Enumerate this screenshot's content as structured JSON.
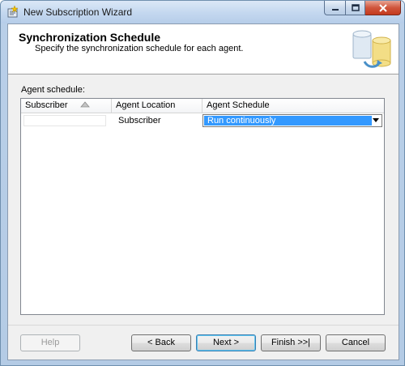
{
  "window": {
    "title": "New Subscription Wizard"
  },
  "header": {
    "title": "Synchronization Schedule",
    "subtitle": "Specify the synchronization schedule for each agent."
  },
  "grid": {
    "label": "Agent schedule:",
    "columns": [
      "Subscriber",
      "Agent Location",
      "Agent Schedule"
    ],
    "sort_column": "Subscriber",
    "sort_direction": "ascending",
    "rows": [
      {
        "subscriber": "",
        "agent_location": "Subscriber",
        "agent_schedule": "Run continuously"
      }
    ]
  },
  "buttons": {
    "help": "Help",
    "back": "< Back",
    "next": "Next >",
    "finish": "Finish >>|",
    "cancel": "Cancel"
  },
  "icons": {
    "app": "wizard-icon",
    "header": "database-sync-icon",
    "sort": "sort-ascending-icon",
    "dropdown": "chevron-down-icon"
  }
}
